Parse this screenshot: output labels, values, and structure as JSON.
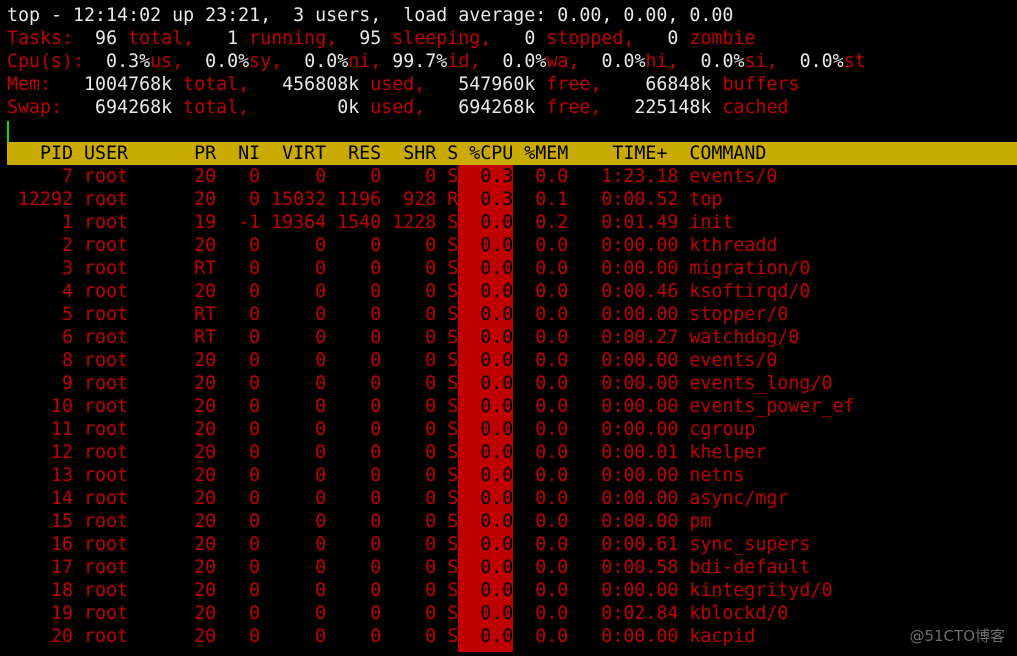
{
  "summary": {
    "line1": [
      {
        "t": "top - 12:14:02 up 23:21,  3 users,  load average: 0.00, 0.00, 0.00",
        "c": "w"
      }
    ],
    "line2": [
      {
        "t": "Tasks:",
        "c": "r"
      },
      {
        "t": "  96 ",
        "c": "w"
      },
      {
        "t": "total,",
        "c": "r"
      },
      {
        "t": "   1 ",
        "c": "w"
      },
      {
        "t": "running,",
        "c": "r"
      },
      {
        "t": "  95 ",
        "c": "w"
      },
      {
        "t": "sleeping,",
        "c": "r"
      },
      {
        "t": "   0 ",
        "c": "w"
      },
      {
        "t": "stopped,",
        "c": "r"
      },
      {
        "t": "   0 ",
        "c": "w"
      },
      {
        "t": "zombie",
        "c": "r"
      }
    ],
    "line3": [
      {
        "t": "Cpu(s):",
        "c": "r"
      },
      {
        "t": "  0.3%",
        "c": "w"
      },
      {
        "t": "us,",
        "c": "r"
      },
      {
        "t": "  0.0%",
        "c": "w"
      },
      {
        "t": "sy,",
        "c": "r"
      },
      {
        "t": "  0.0%",
        "c": "w"
      },
      {
        "t": "ni,",
        "c": "r"
      },
      {
        "t": " 99.7%",
        "c": "w"
      },
      {
        "t": "id,",
        "c": "r"
      },
      {
        "t": "  0.0%",
        "c": "w"
      },
      {
        "t": "wa,",
        "c": "r"
      },
      {
        "t": "  0.0%",
        "c": "w"
      },
      {
        "t": "hi,",
        "c": "r"
      },
      {
        "t": "  0.0%",
        "c": "w"
      },
      {
        "t": "si,",
        "c": "r"
      },
      {
        "t": "  0.0%",
        "c": "w"
      },
      {
        "t": "st",
        "c": "r"
      }
    ],
    "line4": [
      {
        "t": "Mem:",
        "c": "r"
      },
      {
        "t": "   1004768k ",
        "c": "w"
      },
      {
        "t": "total,",
        "c": "r"
      },
      {
        "t": "   456808k ",
        "c": "w"
      },
      {
        "t": "used,",
        "c": "r"
      },
      {
        "t": "   547960k ",
        "c": "w"
      },
      {
        "t": "free,",
        "c": "r"
      },
      {
        "t": "    66848k ",
        "c": "w"
      },
      {
        "t": "buffers",
        "c": "r"
      }
    ],
    "line5": [
      {
        "t": "Swap:",
        "c": "r"
      },
      {
        "t": "   694268k ",
        "c": "w"
      },
      {
        "t": "total,",
        "c": "r"
      },
      {
        "t": "        0k ",
        "c": "w"
      },
      {
        "t": "used,",
        "c": "r"
      },
      {
        "t": "   694268k ",
        "c": "w"
      },
      {
        "t": "free,",
        "c": "r"
      },
      {
        "t": "   225148k ",
        "c": "w"
      },
      {
        "t": "cached",
        "c": "r"
      }
    ]
  },
  "columns": [
    "PID",
    "USER",
    "PR",
    "NI",
    "VIRT",
    "RES",
    "SHR",
    "S",
    "%CPU",
    "%MEM",
    "TIME+",
    "COMMAND"
  ],
  "processes": [
    [
      "7",
      "root",
      "20",
      "0",
      "0",
      "0",
      "0",
      "S",
      "0.3",
      "0.0",
      "1:23.18",
      "events/0"
    ],
    [
      "12292",
      "root",
      "20",
      "0",
      "15032",
      "1196",
      "928",
      "R",
      "0.3",
      "0.1",
      "0:00.52",
      "top"
    ],
    [
      "1",
      "root",
      "19",
      "-1",
      "19364",
      "1540",
      "1228",
      "S",
      "0.0",
      "0.2",
      "0:01.49",
      "init"
    ],
    [
      "2",
      "root",
      "20",
      "0",
      "0",
      "0",
      "0",
      "S",
      "0.0",
      "0.0",
      "0:00.00",
      "kthreadd"
    ],
    [
      "3",
      "root",
      "RT",
      "0",
      "0",
      "0",
      "0",
      "S",
      "0.0",
      "0.0",
      "0:00.00",
      "migration/0"
    ],
    [
      "4",
      "root",
      "20",
      "0",
      "0",
      "0",
      "0",
      "S",
      "0.0",
      "0.0",
      "0:00.46",
      "ksoftirqd/0"
    ],
    [
      "5",
      "root",
      "RT",
      "0",
      "0",
      "0",
      "0",
      "S",
      "0.0",
      "0.0",
      "0:00.00",
      "stopper/0"
    ],
    [
      "6",
      "root",
      "RT",
      "0",
      "0",
      "0",
      "0",
      "S",
      "0.0",
      "0.0",
      "0:00.27",
      "watchdog/0"
    ],
    [
      "8",
      "root",
      "20",
      "0",
      "0",
      "0",
      "0",
      "S",
      "0.0",
      "0.0",
      "0:00.00",
      "events/0"
    ],
    [
      "9",
      "root",
      "20",
      "0",
      "0",
      "0",
      "0",
      "S",
      "0.0",
      "0.0",
      "0:00.00",
      "events_long/0"
    ],
    [
      "10",
      "root",
      "20",
      "0",
      "0",
      "0",
      "0",
      "S",
      "0.0",
      "0.0",
      "0:00.00",
      "events_power_ef"
    ],
    [
      "11",
      "root",
      "20",
      "0",
      "0",
      "0",
      "0",
      "S",
      "0.0",
      "0.0",
      "0:00.00",
      "cgroup"
    ],
    [
      "12",
      "root",
      "20",
      "0",
      "0",
      "0",
      "0",
      "S",
      "0.0",
      "0.0",
      "0:00.01",
      "khelper"
    ],
    [
      "13",
      "root",
      "20",
      "0",
      "0",
      "0",
      "0",
      "S",
      "0.0",
      "0.0",
      "0:00.00",
      "netns"
    ],
    [
      "14",
      "root",
      "20",
      "0",
      "0",
      "0",
      "0",
      "S",
      "0.0",
      "0.0",
      "0:00.00",
      "async/mgr"
    ],
    [
      "15",
      "root",
      "20",
      "0",
      "0",
      "0",
      "0",
      "S",
      "0.0",
      "0.0",
      "0:00.00",
      "pm"
    ],
    [
      "16",
      "root",
      "20",
      "0",
      "0",
      "0",
      "0",
      "S",
      "0.0",
      "0.0",
      "0:00.61",
      "sync_supers"
    ],
    [
      "17",
      "root",
      "20",
      "0",
      "0",
      "0",
      "0",
      "S",
      "0.0",
      "0.0",
      "0:00.58",
      "bdi-default"
    ],
    [
      "18",
      "root",
      "20",
      "0",
      "0",
      "0",
      "0",
      "S",
      "0.0",
      "0.0",
      "0:00.00",
      "kintegrityd/0"
    ],
    [
      "19",
      "root",
      "20",
      "0",
      "0",
      "0",
      "0",
      "S",
      "0.0",
      "0.0",
      "0:02.84",
      "kblockd/0"
    ],
    [
      "20",
      "root",
      "20",
      "0",
      "0",
      "0",
      "0",
      "S",
      "0.0",
      "0.0",
      "0:00.00",
      "kacpid"
    ]
  ],
  "colors": {
    "label": "#c00000",
    "value": "#e8e8e8",
    "header_bar": "#c9ab00",
    "cpu_highlight": "#c00000",
    "cursor": "#00e000",
    "background": "#000000"
  },
  "watermark": "@51CTO博客"
}
